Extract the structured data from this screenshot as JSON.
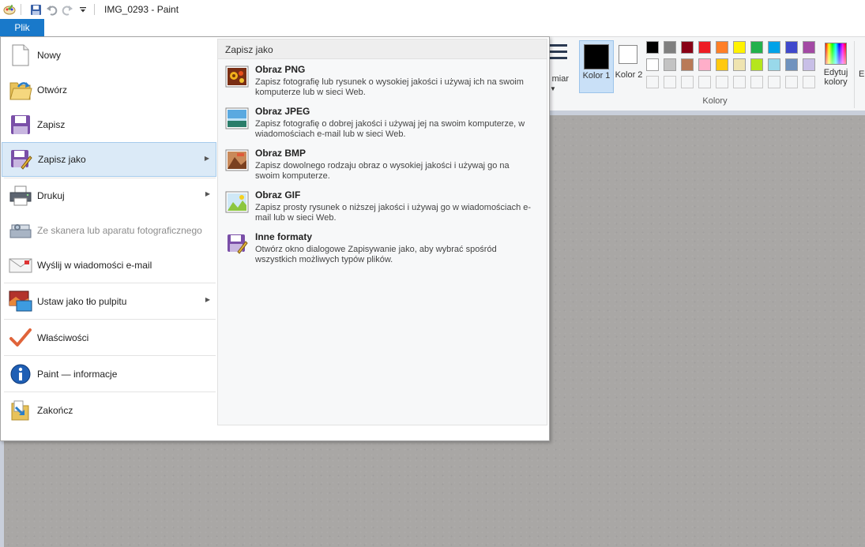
{
  "window": {
    "title": "IMG_0293 - Paint"
  },
  "ribbon": {
    "file_tab": "Plik",
    "size_label": "miar",
    "color1_label": "Kolor 1",
    "color2_label": "Kolor 2",
    "colors_group_label": "Kolory",
    "edit_colors_label": "Edytuj kolory",
    "cutoff_label": "E",
    "palette_row1": [
      "#000000",
      "#7f7f7f",
      "#880015",
      "#ed1c24",
      "#ff7f27",
      "#fff200",
      "#22b14c",
      "#00a2e8",
      "#3f48cc",
      "#a349a4"
    ],
    "palette_row2": [
      "#ffffff",
      "#c3c3c3",
      "#b97a57",
      "#ffaec9",
      "#ffc90e",
      "#efe4b0",
      "#b5e61d",
      "#99d9ea",
      "#7092be",
      "#c8bfe7"
    ]
  },
  "file_menu": {
    "items": [
      {
        "label": "Nowy",
        "icon": "new-document-icon",
        "disabled": false,
        "submenu": false
      },
      {
        "label": "Otwórz",
        "icon": "open-folder-icon",
        "disabled": false,
        "submenu": false
      },
      {
        "label": "Zapisz",
        "icon": "save-disk-icon",
        "disabled": false,
        "submenu": false
      },
      {
        "label": "Zapisz jako",
        "icon": "save-as-icon",
        "disabled": false,
        "submenu": true
      },
      {
        "label": "Drukuj",
        "icon": "printer-icon",
        "disabled": false,
        "submenu": true
      },
      {
        "label": "Ze skanera lub aparatu fotograficznego",
        "icon": "scanner-icon",
        "disabled": true,
        "submenu": false
      },
      {
        "label": "Wyślij w wiadomości e-mail",
        "icon": "email-icon",
        "disabled": false,
        "submenu": false
      },
      {
        "label": "Ustaw jako tło pulpitu",
        "icon": "desktop-background-icon",
        "disabled": false,
        "submenu": true
      },
      {
        "label": "Właściwości",
        "icon": "checkmark-icon",
        "disabled": false,
        "submenu": false
      },
      {
        "label": "Paint — informacje",
        "icon": "info-icon",
        "disabled": false,
        "submenu": false
      },
      {
        "label": "Zakończ",
        "icon": "exit-icon",
        "disabled": false,
        "submenu": false
      }
    ],
    "save_as_panel": {
      "header": "Zapisz jako",
      "options": [
        {
          "title": "Obraz PNG",
          "description": "Zapisz fotografię lub rysunek o wysokiej jakości i używaj ich na swoim komputerze lub w sieci Web.",
          "icon": "png-image-icon"
        },
        {
          "title": "Obraz JPEG",
          "description": "Zapisz fotografię o dobrej jakości i używaj jej na swoim komputerze, w wiadomościach e-mail lub w sieci Web.",
          "icon": "jpeg-image-icon"
        },
        {
          "title": "Obraz BMP",
          "description": "Zapisz dowolnego rodzaju obraz o wysokiej jakości i używaj go na swoim komputerze.",
          "icon": "bmp-image-icon"
        },
        {
          "title": "Obraz GIF",
          "description": "Zapisz prosty rysunek o niższej jakości i używaj go w wiadomościach e-mail lub w sieci Web.",
          "icon": "gif-image-icon"
        },
        {
          "title": "Inne formaty",
          "description": "Otwórz okno dialogowe Zapisywanie jako, aby wybrać spośród wszystkich możliwych typów plików.",
          "icon": "other-formats-icon"
        }
      ]
    }
  }
}
